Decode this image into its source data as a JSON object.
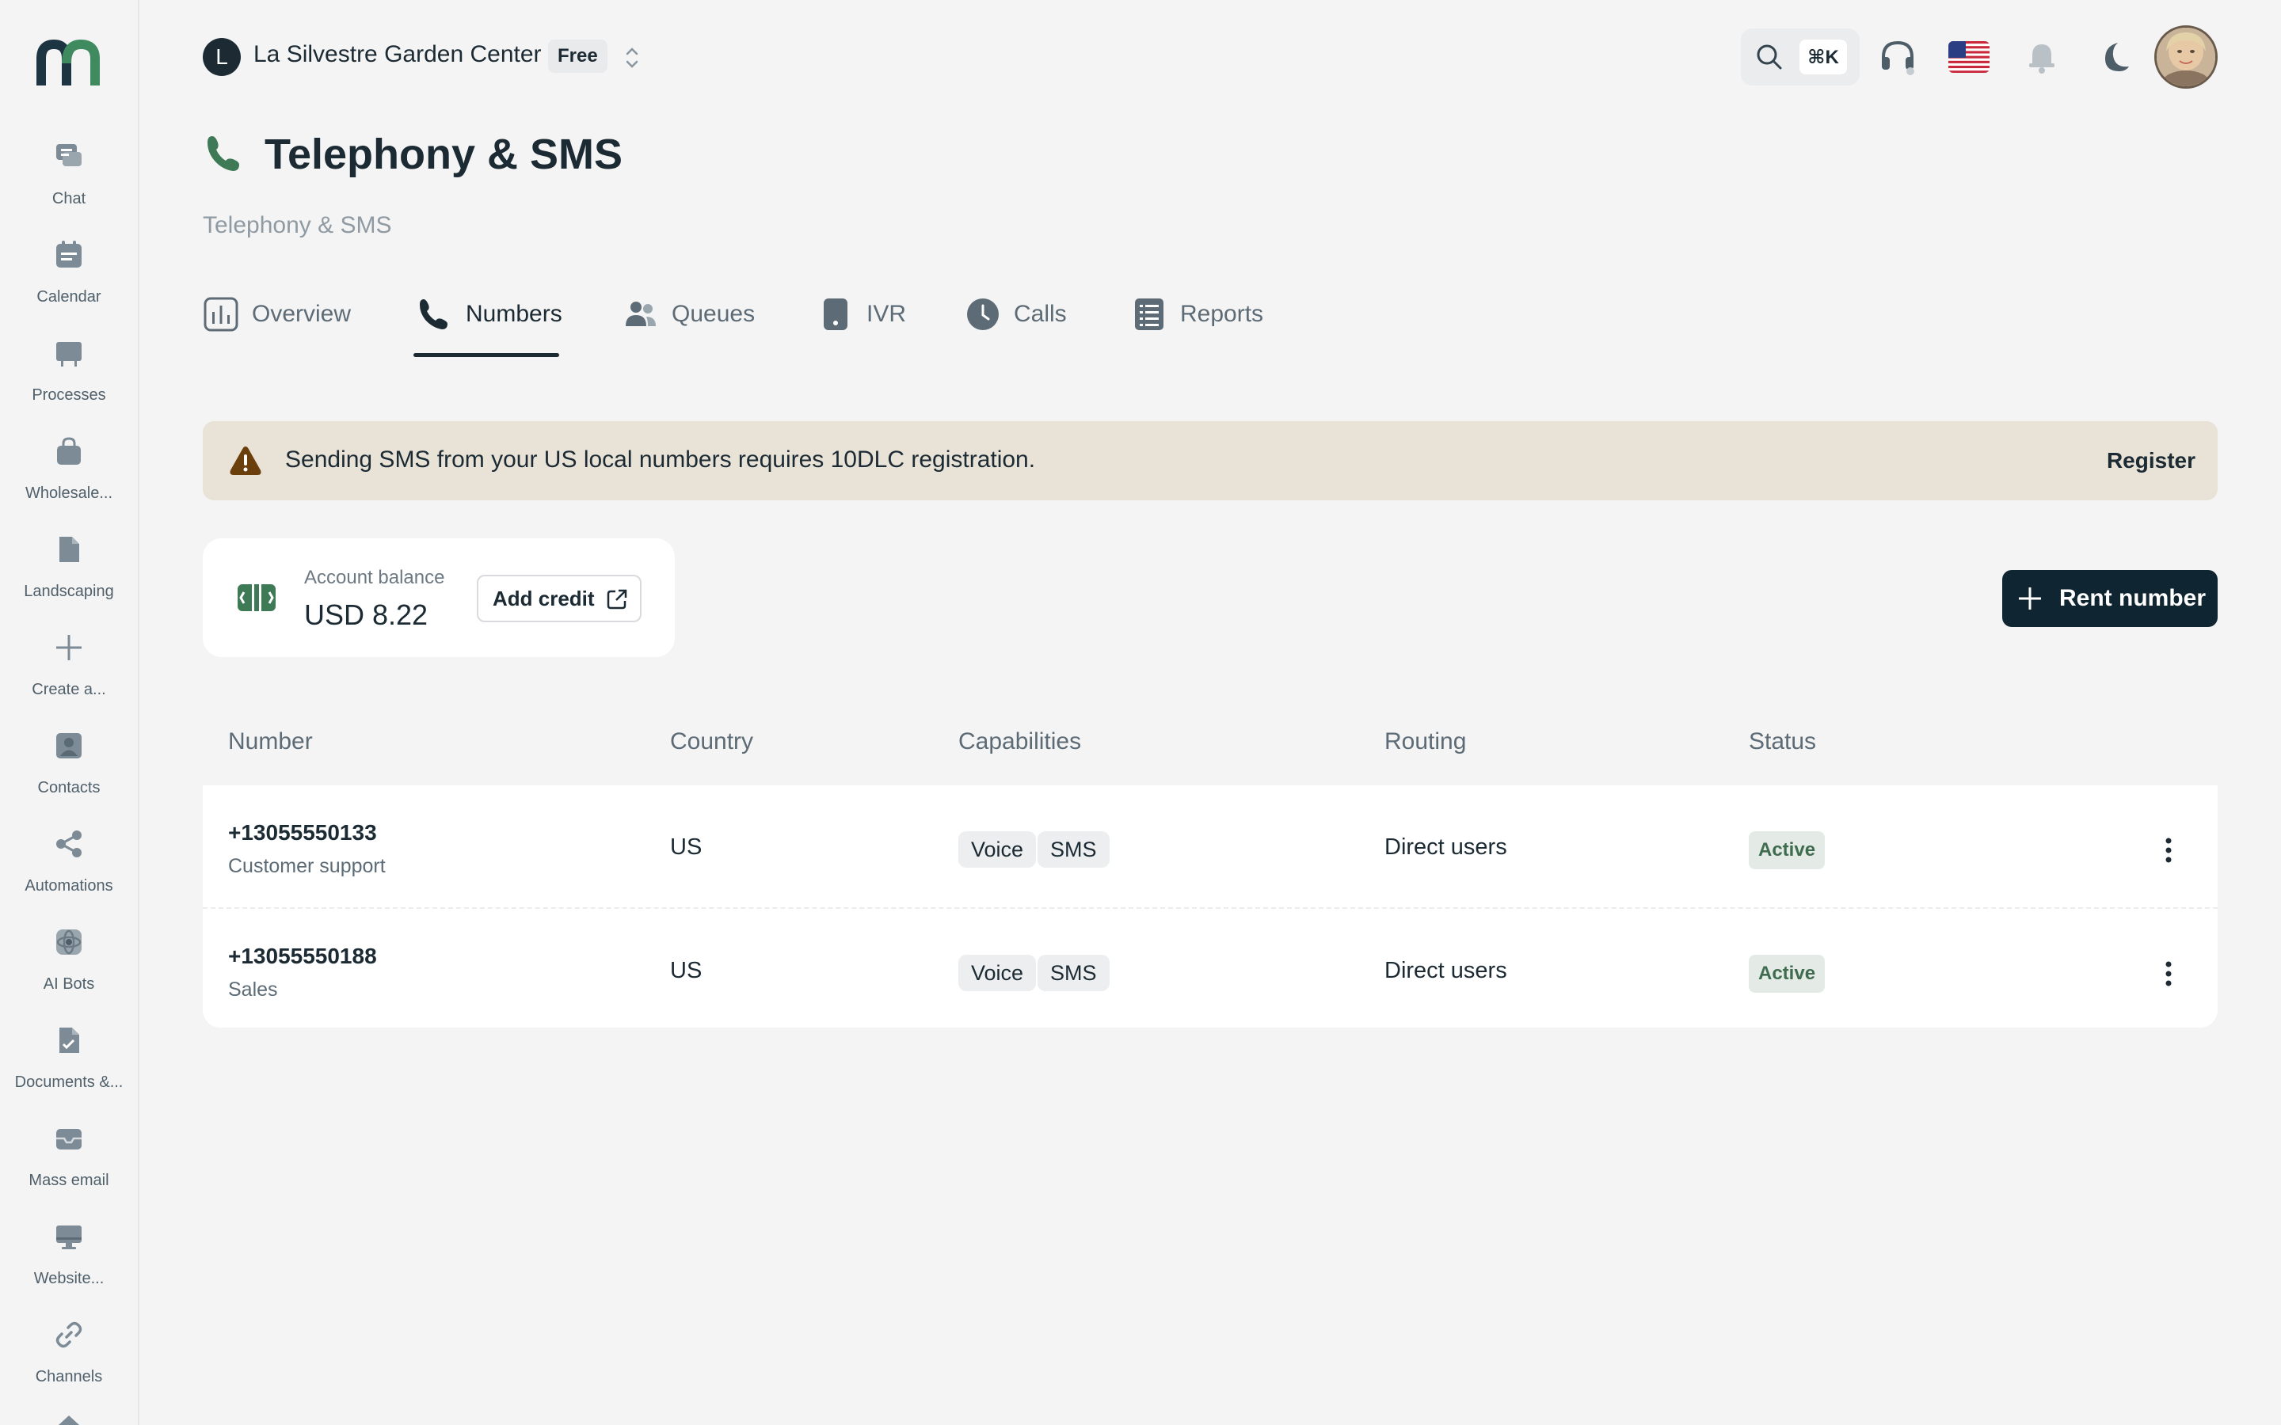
{
  "sidebar": {
    "items": [
      {
        "label": "Chat",
        "icon": "chat-icon"
      },
      {
        "label": "Calendar",
        "icon": "calendar-icon"
      },
      {
        "label": "Processes",
        "icon": "board-icon"
      },
      {
        "label": "Wholesale...",
        "icon": "bag-icon"
      },
      {
        "label": "Landscaping",
        "icon": "file-icon"
      },
      {
        "label": "Create a...",
        "icon": "plus-icon"
      },
      {
        "label": "Contacts",
        "icon": "contact-icon"
      },
      {
        "label": "Automations",
        "icon": "share-icon"
      },
      {
        "label": "AI Bots",
        "icon": "ai-bot-icon"
      },
      {
        "label": "Documents &...",
        "icon": "document-icon"
      },
      {
        "label": "Mass email",
        "icon": "mail-icon"
      },
      {
        "label": "Website...",
        "icon": "monitor-icon"
      },
      {
        "label": "Channels",
        "icon": "link-icon"
      }
    ]
  },
  "header": {
    "org_initial": "L",
    "org_name": "La Silvestre Garden Center",
    "plan": "Free",
    "search_shortcut": "⌘K"
  },
  "page": {
    "title": "Telephony & SMS",
    "breadcrumb": "Telephony & SMS"
  },
  "tabs": [
    {
      "label": "Overview",
      "icon": "chart-icon"
    },
    {
      "label": "Numbers",
      "icon": "phone-icon",
      "active": true
    },
    {
      "label": "Queues",
      "icon": "users-icon"
    },
    {
      "label": "IVR",
      "icon": "mobile-icon"
    },
    {
      "label": "Calls",
      "icon": "clock-icon"
    },
    {
      "label": "Reports",
      "icon": "list-icon"
    }
  ],
  "alert": {
    "text": "Sending SMS from your US local numbers requires 10DLC registration.",
    "action": "Register"
  },
  "balance": {
    "label": "Account balance",
    "value": "USD 8.22",
    "add_credit": "Add credit"
  },
  "rent_button": "Rent number",
  "table": {
    "columns": [
      "Number",
      "Country",
      "Capabilities",
      "Routing",
      "Status"
    ],
    "rows": [
      {
        "number": "+13055550133",
        "description": "Customer support",
        "country": "US",
        "capabilities": [
          "Voice",
          "SMS"
        ],
        "routing": "Direct users",
        "status": "Active"
      },
      {
        "number": "+13055550188",
        "description": "Sales",
        "country": "US",
        "capabilities": [
          "Voice",
          "SMS"
        ],
        "routing": "Direct users",
        "status": "Active"
      }
    ]
  },
  "colors": {
    "accent_green": "#3f7a57",
    "dark_navy": "#102532",
    "alert_bg": "#e9e2d7",
    "status_bg": "#e4ebe6"
  }
}
